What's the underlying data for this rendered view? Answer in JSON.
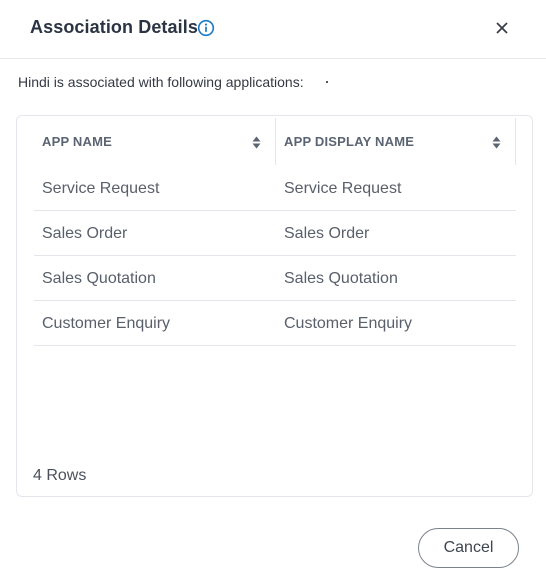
{
  "dialog": {
    "title": "Association Details",
    "subtitle": "Hindi is associated with following applications:",
    "accent_color": "#1a7ac4"
  },
  "table": {
    "columns": [
      "APP NAME",
      "APP DISPLAY NAME"
    ],
    "rows": [
      [
        "Service Request",
        "Service Request"
      ],
      [
        "Sales Order",
        "Sales Order"
      ],
      [
        "Sales Quotation",
        "Sales Quotation"
      ],
      [
        "Customer Enquiry",
        "Customer Enquiry"
      ]
    ],
    "row_count_label": "4 Rows"
  },
  "footer": {
    "cancel_label": "Cancel"
  },
  "icons": {
    "info": "info-icon",
    "close": "close-icon",
    "sort": "sort-icon"
  }
}
